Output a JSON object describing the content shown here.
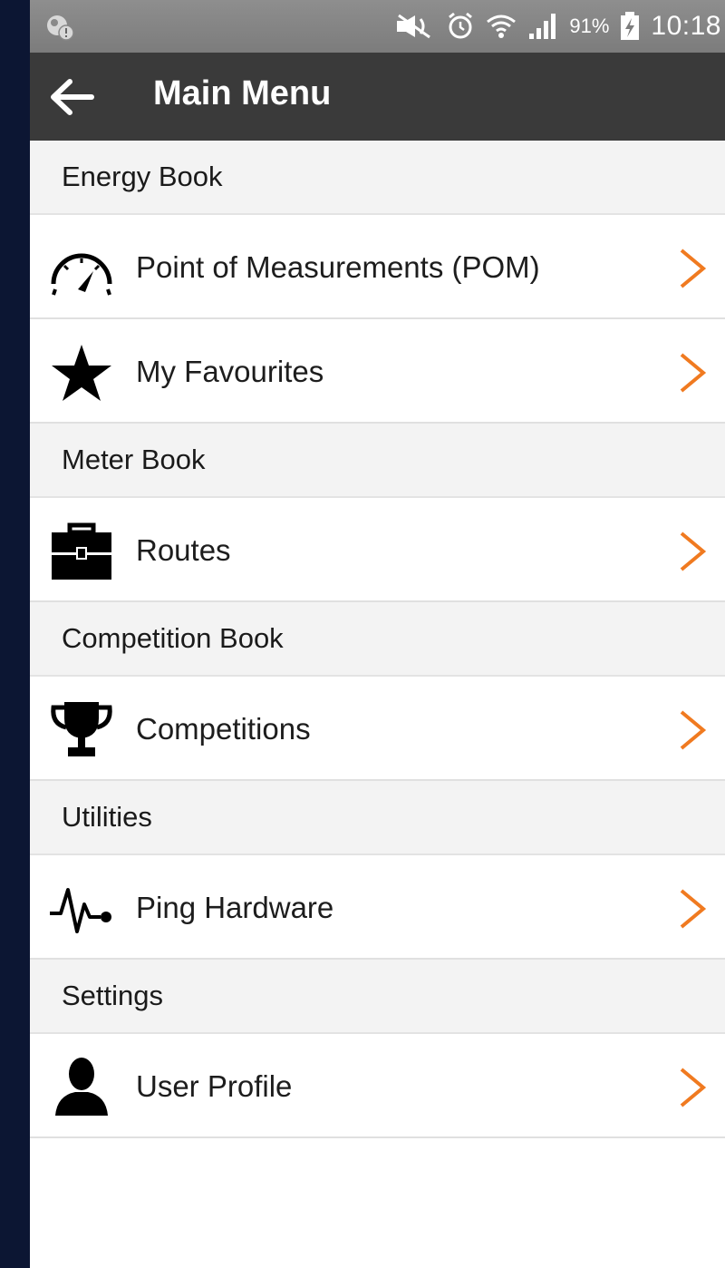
{
  "status_bar": {
    "battery_percent": "91%",
    "time": "10:18",
    "icons": [
      "notification-icon",
      "mute-icon",
      "alarm-icon",
      "wifi-icon",
      "signal-icon",
      "battery-charging-icon"
    ]
  },
  "app_bar": {
    "title": "Main Menu",
    "back_icon": "back-arrow-icon"
  },
  "menu": {
    "sections": [
      {
        "title": "Energy Book",
        "items": [
          {
            "label": "Point of Measurements (POM)",
            "icon": "gauge-icon"
          },
          {
            "label": "My Favourites",
            "icon": "star-icon"
          }
        ]
      },
      {
        "title": "Meter Book",
        "items": [
          {
            "label": "Routes",
            "icon": "toolbox-icon"
          }
        ]
      },
      {
        "title": "Competition Book",
        "items": [
          {
            "label": "Competitions",
            "icon": "trophy-icon"
          }
        ]
      },
      {
        "title": "Utilities",
        "items": [
          {
            "label": "Ping Hardware",
            "icon": "pulse-icon"
          }
        ]
      },
      {
        "title": "Settings",
        "items": [
          {
            "label": "User Profile",
            "icon": "user-icon"
          }
        ]
      }
    ]
  },
  "colors": {
    "app_bar": "#3a3a3a",
    "status_bar": "#858585",
    "section_bg": "#f3f3f3",
    "chevron": "#f07a20"
  }
}
